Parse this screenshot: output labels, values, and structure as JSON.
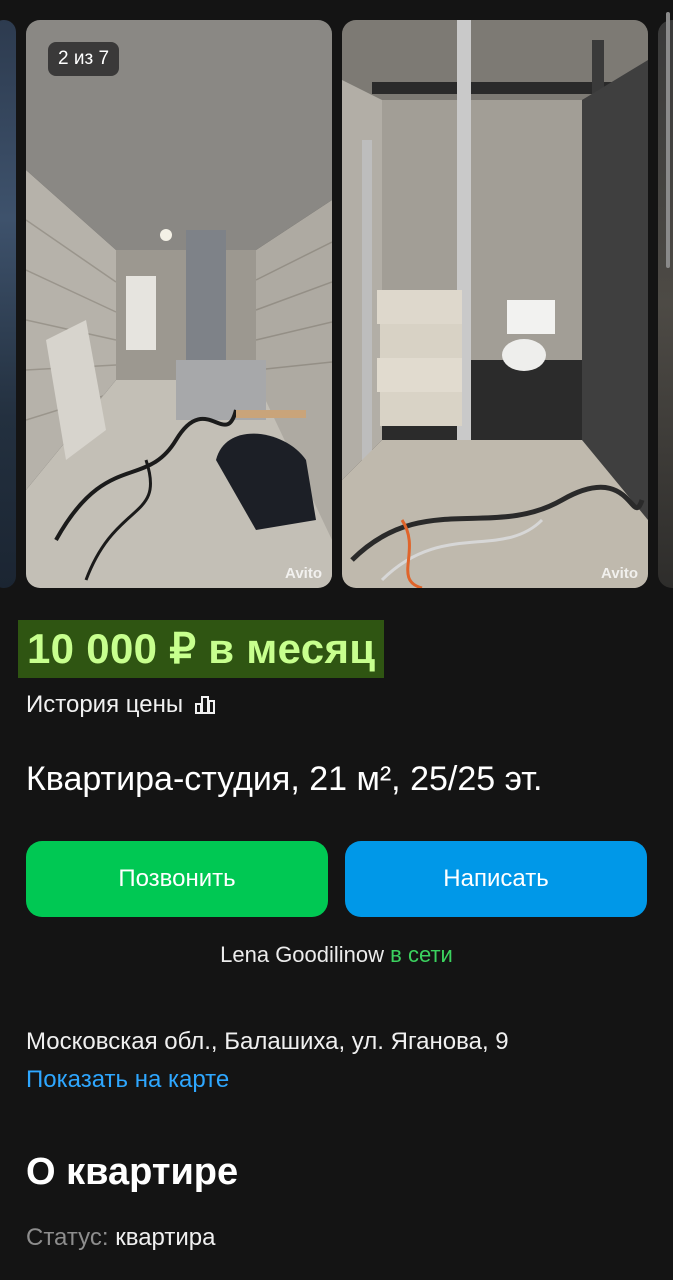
{
  "gallery": {
    "counter": "2 из 7",
    "watermark": "Avito",
    "photos": [
      "room-corridor-photo",
      "bathroom-photo"
    ]
  },
  "listing": {
    "price": "10 000 ₽ в месяц",
    "price_history_label": "История цены",
    "title": "Квартира-студия, 21 м², 25/25 эт."
  },
  "actions": {
    "call_label": "Позвонить",
    "write_label": "Написать"
  },
  "seller": {
    "name": "Lena Goodilinow",
    "status": "в сети"
  },
  "location": {
    "address": "Московская обл., Балашиха, ул. Яганова, 9",
    "map_link": "Показать на карте"
  },
  "about": {
    "heading": "О квартире",
    "status_label": "Статус:",
    "status_value": "квартира"
  },
  "colors": {
    "background": "#141414",
    "price_highlight_bg": "#2f5512",
    "price_text": "#c7ff8e",
    "call_button": "#00c853",
    "write_button": "#0098e8",
    "online": "#3bd25f",
    "link": "#2ea7ff"
  },
  "icons": {
    "price_history": "bar-chart-icon"
  }
}
